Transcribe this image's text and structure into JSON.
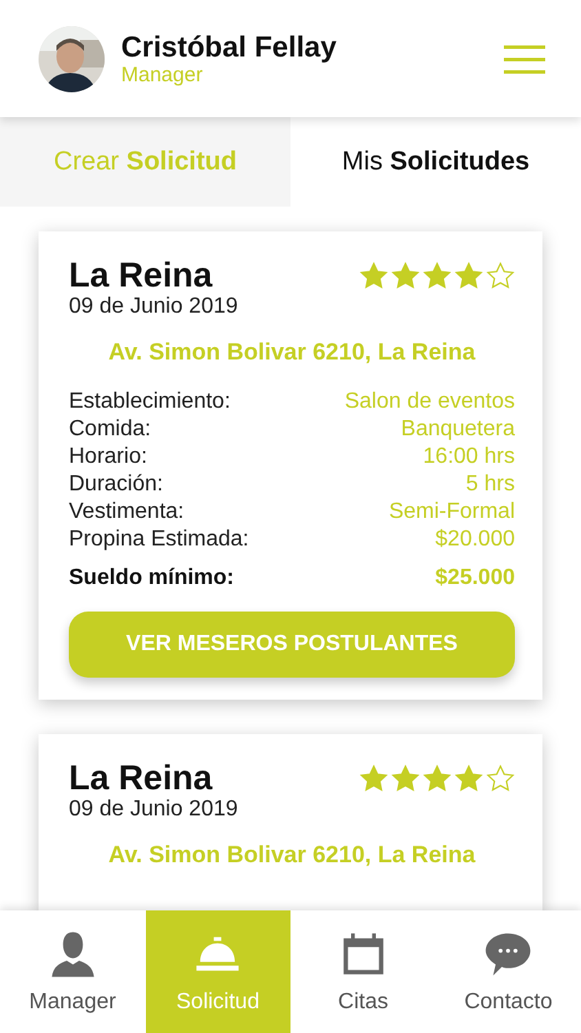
{
  "header": {
    "name": "Cristóbal Fellay",
    "role": "Manager"
  },
  "tabs": [
    {
      "label": "Crear **Solicitud**",
      "selected": false
    },
    {
      "label": "Mis **Solicitudes**",
      "selected": true
    }
  ],
  "cards": [
    {
      "title": "La Reina",
      "date": "09 de Junio 2019",
      "stars": 4,
      "address": "Av. Simon Bolivar 6210, La Reina",
      "details": [
        {
          "label": "Establecimiento:",
          "value": "Salon de eventos"
        },
        {
          "label": "Comida:",
          "value": "Banquetera"
        },
        {
          "label": "Horario:",
          "value": "16:00 hrs"
        },
        {
          "label": "Duración:",
          "value": "5 hrs"
        },
        {
          "label": "Vestimenta:",
          "value": "Semi-Formal"
        },
        {
          "label": "Propina Estimada:",
          "value": "$20.000"
        }
      ],
      "wage": {
        "label": "Sueldo mínimo:",
        "value": "$25.000"
      },
      "button": "VER MESEROS POSTULANTES"
    },
    {
      "title": "La Reina",
      "date": "09 de Junio 2019",
      "stars": 4,
      "address": "Av. Simon Bolivar 6210, La Reina"
    }
  ],
  "nav": [
    {
      "label": "Manager",
      "kind": "person",
      "selected": false
    },
    {
      "label": "Solicitud",
      "kind": "bell",
      "selected": true
    },
    {
      "label": "Citas",
      "kind": "calendar",
      "selected": false
    },
    {
      "label": "Contacto",
      "kind": "chat",
      "selected": false
    }
  ]
}
